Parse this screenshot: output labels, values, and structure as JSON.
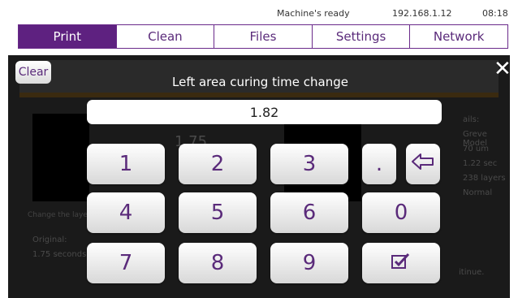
{
  "status": {
    "state": "Machine's ready",
    "ip": "192.168.1.12",
    "time": "08:18"
  },
  "tabs": [
    "Print",
    "Clean",
    "Files",
    "Settings",
    "Network"
  ],
  "dialog": {
    "clear_label": "Clear",
    "title": "Left area curing time change",
    "value": "1.82"
  },
  "keys": {
    "k1": "1",
    "k2": "2",
    "k3": "3",
    "dot": ".",
    "k4": "4",
    "k5": "5",
    "k6": "6",
    "k0": "0",
    "k7": "7",
    "k8": "8",
    "k9": "9"
  },
  "background": {
    "orig_label": "Original:",
    "orig_value": "1.75 seconds",
    "change_hint": "Change the layer",
    "value_preview": "1.75",
    "details_label": "ails:",
    "model": "Greve Model",
    "layer_um": "70 um",
    "sec": "1.22 sec",
    "layers": "238 layers",
    "mode": "Normal",
    "continue": "itinue."
  },
  "colors": {
    "accent": "#5e2180",
    "overlay": "#1a1a1a",
    "key_text": "#5a2a7a"
  }
}
